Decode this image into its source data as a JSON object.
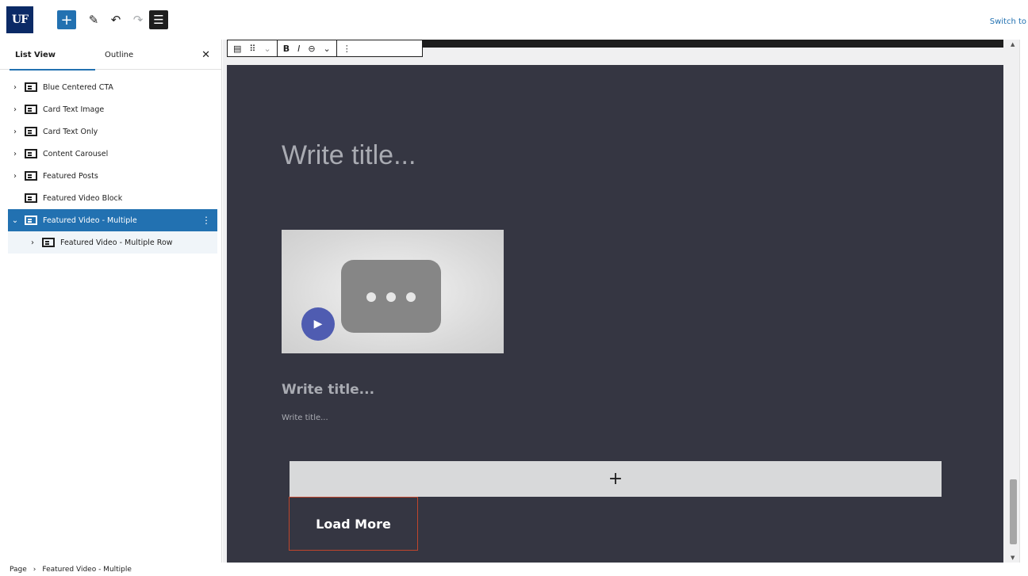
{
  "header": {
    "logo_text": "UF",
    "add_icon": "plus-icon",
    "switch_link": "Switch to"
  },
  "sidebar": {
    "tabs": [
      {
        "label": "List View"
      },
      {
        "label": "Outline"
      }
    ],
    "close_icon": "close-icon",
    "items": [
      {
        "label": "Blue Centered CTA"
      },
      {
        "label": "Card Text Image"
      },
      {
        "label": "Card Text Only"
      },
      {
        "label": "Content Carousel"
      },
      {
        "label": "Featured Posts"
      },
      {
        "label": "Featured Video Block"
      },
      {
        "label": "Featured Video - Multiple"
      },
      {
        "label": "Featured Video - Multiple Row"
      }
    ]
  },
  "toolbar": {
    "bold": "B",
    "italic": "I",
    "more": "⋮"
  },
  "canvas": {
    "title_placeholder": "Write title...",
    "video_title_placeholder": "Write title...",
    "video_subtitle_placeholder": "Write title...",
    "appender_icon": "+",
    "load_more": "Load More"
  },
  "footer": {
    "crumbs": [
      "Page",
      "Featured Video - Multiple"
    ]
  },
  "colors": {
    "accent": "#2271b1",
    "canvas_bg": "#353642",
    "play_button": "#4f5cb1",
    "load_more_border": "#c0452c",
    "logo_bg": "#0b2a66"
  }
}
